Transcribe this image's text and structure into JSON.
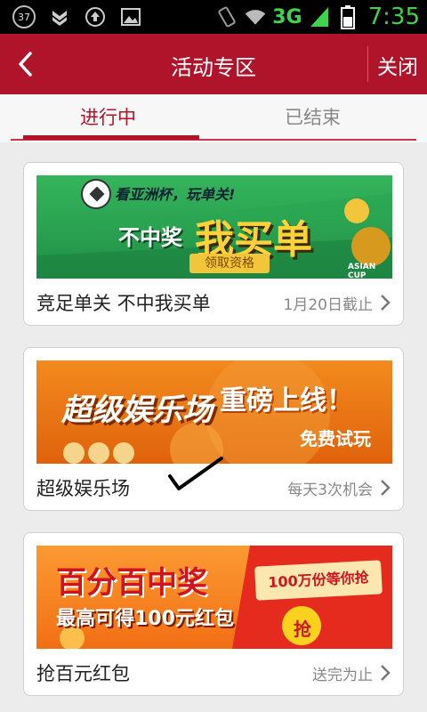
{
  "status_bar": {
    "notification_count": "37",
    "network": "3G",
    "time": "7:35"
  },
  "header": {
    "title": "活动专区",
    "close_label": "关闭"
  },
  "tabs": [
    {
      "label": "进行中"
    },
    {
      "label": "已结束"
    }
  ],
  "activities": [
    {
      "title": "竞足单关 不中我买单",
      "status": "1月20日截止",
      "banner": {
        "line1": "看亚洲杯，玩单关!",
        "line2a": "不中奖",
        "line2b": "我买单",
        "button": "领取资格",
        "logo": "ASIAN CUP"
      }
    },
    {
      "title": "超级娱乐场",
      "status": "每天3次机会",
      "banner": {
        "line1": "超级娱乐场",
        "line2": "重磅上线！",
        "line3": "免费试玩"
      }
    },
    {
      "title": "抢百元红包",
      "status": "送完为止",
      "banner": {
        "line1": "百分百中奖",
        "line2": "最高可得100元红包",
        "badge": "100万份等你抢",
        "grab": "抢"
      }
    }
  ],
  "colors": {
    "brand": "#b0142a",
    "status_green": "#3fd24a",
    "background": "#ececec"
  }
}
